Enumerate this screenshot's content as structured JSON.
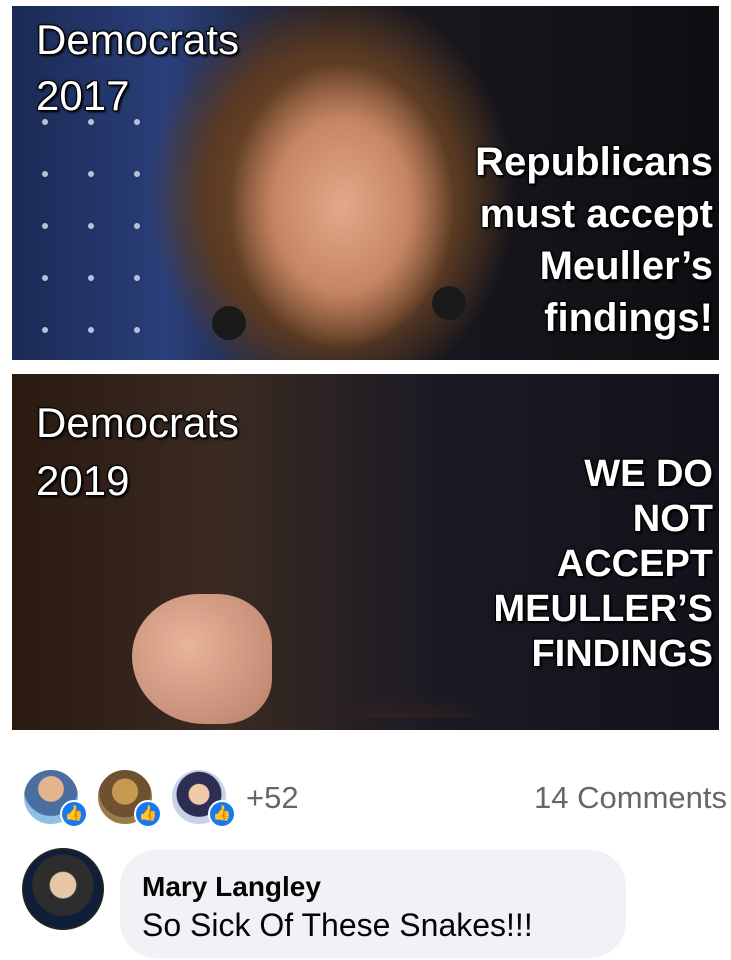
{
  "meme": {
    "top_panel": {
      "label": "Democrats\n2017",
      "label_line1": "Democrats",
      "label_line2": "2017",
      "quote_lines": [
        "Republicans",
        "must accept",
        "Meuller’s",
        "findings!"
      ]
    },
    "bottom_panel": {
      "label_line1": "Democrats",
      "label_line2": "2019",
      "quote_lines": [
        "WE DO",
        "NOT",
        "ACCEPT",
        "MEULLER’S",
        "FINDINGS"
      ]
    }
  },
  "reactions": {
    "count": "+52",
    "comments": "14 Comments",
    "like_icon": "thumbs-up-icon",
    "like_color": "#1877f2"
  },
  "comment": {
    "author": "Mary Langley",
    "text": "So Sick Of These Snakes!!!",
    "bubble_color": "#f0f2f5"
  }
}
